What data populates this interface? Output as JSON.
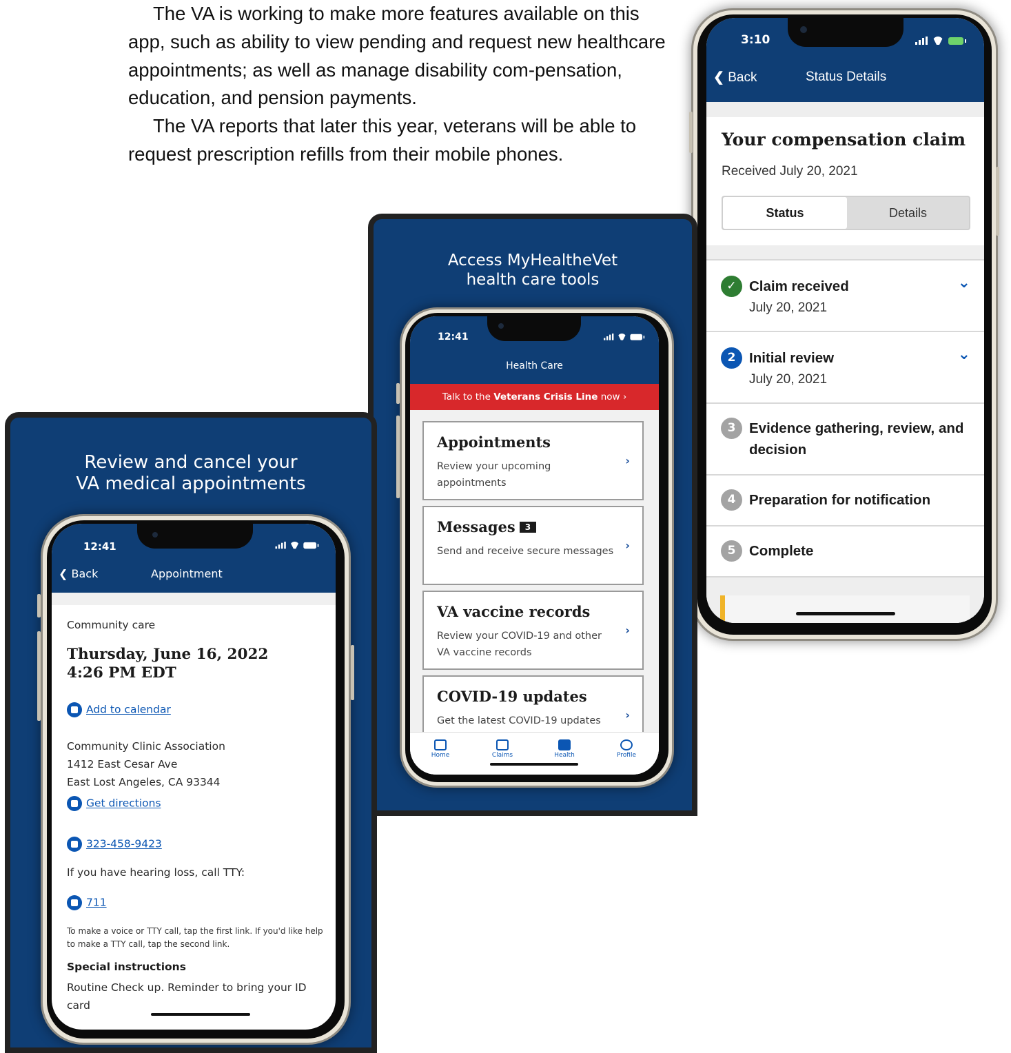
{
  "article": {
    "paragraph_1": "The VA is working to make more features available on this app, such as ability to view pending and request new healthcare appointments; as well as manage disability com-pensation, education, and pension payments.",
    "paragraph_2": "The VA reports that later this year, veterans will be able to request prescription refills from their mobile phones."
  },
  "appointment_card": {
    "title_line1": "Review and cancel your",
    "title_line2": "VA medical appointments",
    "status_time": "12:41",
    "back_label": "Back",
    "nav_title": "Appointment",
    "type_label": "Community care",
    "date_line1": "Thursday, June 16, 2022",
    "date_line2": "4:26 PM EDT",
    "add_to_calendar": "Add to calendar",
    "clinic_name": "Community Clinic Association",
    "address_line1": "1412 East Cesar Ave",
    "address_line2": "East Lost Angeles, CA 93344",
    "get_directions": "Get directions",
    "phone": "323-458-9423",
    "tty_text": "If you have hearing loss, call TTY:",
    "tty_number": "711",
    "call_note": "To make a voice or TTY call, tap the first link. If you'd like help to make a TTY call, tap the second link.",
    "special_heading": "Special instructions",
    "special_text": "Routine Check up. Reminder to bring your ID card"
  },
  "health_card": {
    "title_line1": "Access MyHealtheVet",
    "title_line2": "health care tools",
    "status_time": "12:41",
    "nav_title": "Health Care",
    "crisis_prefix": "Talk to the",
    "crisis_bold": "Veterans Crisis Line",
    "crisis_suffix": "now ›",
    "items": [
      {
        "title": "Appointments",
        "desc": "Review your upcoming appointments"
      },
      {
        "title": "Messages",
        "badge": "3",
        "desc": "Send and receive secure messages"
      },
      {
        "title": "VA vaccine records",
        "desc": "Review your COVID-19 and other VA vaccine records"
      },
      {
        "title": "COVID-19 updates",
        "desc": "Get the latest COVID-19 updates"
      }
    ],
    "tabs": [
      "Home",
      "Claims",
      "Health",
      "Profile"
    ]
  },
  "claim_card": {
    "status_time": "3:10",
    "back_label": "Back",
    "nav_title": "Status Details",
    "heading": "Your compensation claim",
    "received": "Received July 20, 2021",
    "tab_status": "Status",
    "tab_details": "Details",
    "steps": [
      {
        "num": "",
        "title": "Claim received",
        "date": "July 20, 2021"
      },
      {
        "num": "2",
        "title": "Initial review",
        "date": "July 20, 2021"
      },
      {
        "num": "3",
        "title": "Evidence gathering, review, and",
        "title2": "decision"
      },
      {
        "num": "4",
        "title": "Preparation for notification"
      },
      {
        "num": "5",
        "title": "Complete"
      }
    ]
  },
  "colors": {
    "va_blue": "#0f3e75",
    "crisis_red": "#d8282b",
    "link_blue": "#0b56b3",
    "complete_green": "#2e7d32",
    "pending_gray": "#9a9a9a"
  }
}
